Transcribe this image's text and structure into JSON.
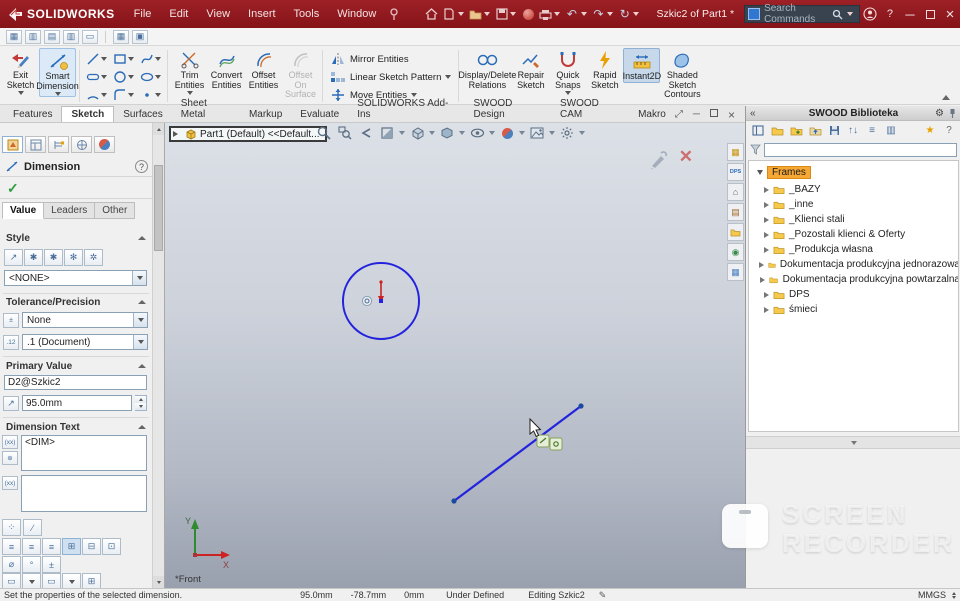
{
  "titlebar": {
    "brand": "SOLIDWORKS",
    "menus": [
      "File",
      "Edit",
      "View",
      "Insert",
      "Tools",
      "Window"
    ],
    "doc_title": "Szkic2 of Part1 *",
    "search_placeholder": "Search Commands"
  },
  "ribbon": {
    "exit_sketch": "Exit Sketch",
    "smart_dimension": "Smart Dimension",
    "trim_entities": "Trim Entities",
    "convert_entities": "Convert Entities",
    "offset_entities": "Offset Entities",
    "offset_on_surface": "Offset On Surface",
    "mirror_entities": "Mirror Entities",
    "linear_sketch_pattern": "Linear Sketch Pattern",
    "move_entities": "Move Entities",
    "display_delete_relations": "Display/Delete Relations",
    "repair_sketch": "Repair Sketch",
    "quick_snaps": "Quick Snaps",
    "rapid_sketch": "Rapid Sketch",
    "instant2d": "Instant2D",
    "shaded_sketch_contours": "Shaded Sketch Contours"
  },
  "tabs": {
    "items": [
      "Features",
      "Sketch",
      "Surfaces",
      "Sheet Metal",
      "Markup",
      "Evaluate",
      "SOLIDWORKS Add-Ins",
      "SWOOD Design",
      "SWOOD CAM",
      "Makro"
    ],
    "active": "Sketch"
  },
  "property_panel": {
    "title": "Dimension",
    "tabs": [
      "Value",
      "Leaders",
      "Other"
    ],
    "style_label": "Style",
    "style_value": "<NONE>",
    "tolerance_label": "Tolerance/Precision",
    "tolerance_value": "None",
    "precision_value": ".1 (Document)",
    "primary_label": "Primary Value",
    "primary_name": "D2@Szkic2",
    "primary_value": "95.0mm",
    "dimension_text_label": "Dimension Text",
    "dimension_text_value": "<DIM>"
  },
  "viewport": {
    "tree_label": "Part1 (Default) <<Default...",
    "plane_label": "*Front",
    "axis_x": "X",
    "axis_y": "Y"
  },
  "swood_panel": {
    "title": "SWOOD Biblioteka",
    "root_item": "Frames",
    "items": [
      "_BAZY",
      "_inne",
      "_Klienci stali",
      "_Pozostali klienci & Oferty",
      "_Produkcja własna",
      "Dokumentacja produkcyjna jednorazowa",
      "Dokumentacja produkcyjna powtarzalna",
      "DPS",
      "śmieci"
    ]
  },
  "statusbar": {
    "message": "Set the properties of the selected dimension.",
    "coord_x": "95.0mm",
    "coord_y": "-78.7mm",
    "coord_z": "0mm",
    "state": "Under Defined",
    "editing": "Editing Szkic2",
    "units": "MMGS"
  },
  "watermark": {
    "line1": "SCREEN",
    "line2": "RECORDER"
  },
  "colors": {
    "titlebar_red": "#8e1a1f",
    "sketch_blue": "#2323dd",
    "selection_orange": "#f7a733",
    "accent_blue": "#2b6cb8"
  }
}
